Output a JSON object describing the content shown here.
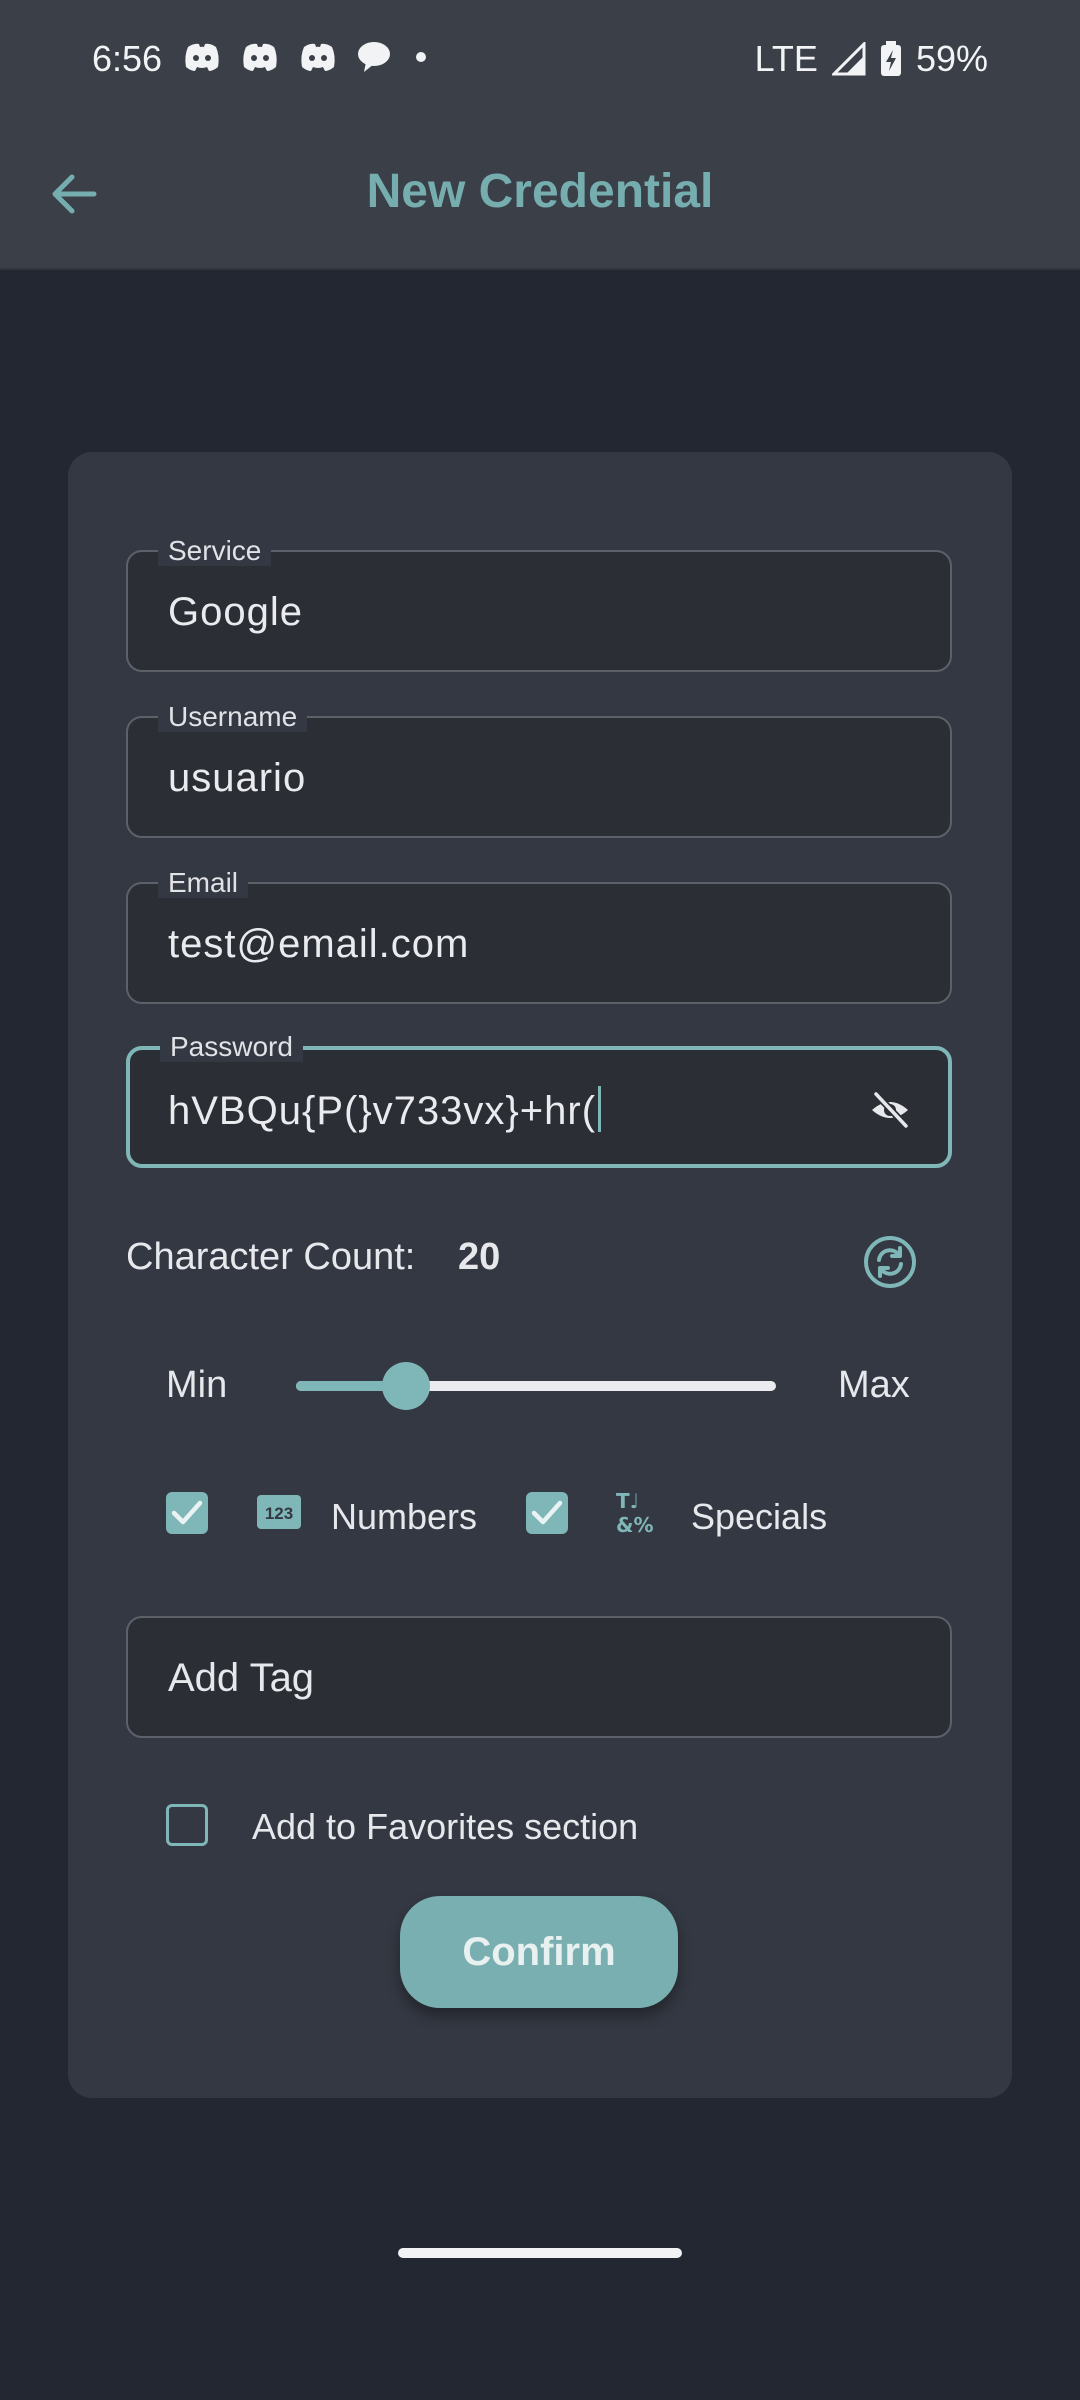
{
  "status_bar": {
    "time": "6:56",
    "network": "LTE",
    "battery": "59%",
    "left_icons": [
      "discord-icon",
      "discord-icon",
      "discord-icon",
      "chat-bubble-icon",
      "more-dot-icon"
    ],
    "right_icons": [
      "signal-icon",
      "battery-charging-icon"
    ]
  },
  "app_bar": {
    "title": "New Credential",
    "back_icon": "arrow-left-icon"
  },
  "form": {
    "service": {
      "label": "Service",
      "value": "Google"
    },
    "username": {
      "label": "Username",
      "value": "usuario"
    },
    "email": {
      "label": "Email",
      "value": "test@email.com"
    },
    "password": {
      "label": "Password",
      "value": "hVBQu{P(}v733vx}+hr(",
      "toggle_icon": "eye-off-icon"
    },
    "character_count": {
      "label": "Character Count:",
      "value": "20",
      "refresh_icon": "refresh-icon"
    },
    "slider": {
      "min_label": "Min",
      "max_label": "Max",
      "level": 0.23
    },
    "options": [
      {
        "label": "Numbers",
        "checked": true,
        "icon": "numbers-123-icon"
      },
      {
        "label": "Specials",
        "checked": true,
        "icon": "special-characters-icon"
      }
    ],
    "tag": {
      "placeholder": "Add Tag"
    },
    "favorites": {
      "label": "Add to Favorites section",
      "checked": false
    },
    "confirm_label": "Confirm"
  },
  "colors": {
    "accent": "#7fb6b8",
    "background": "#222731",
    "card": "#343842",
    "bar": "#3a3f48"
  }
}
